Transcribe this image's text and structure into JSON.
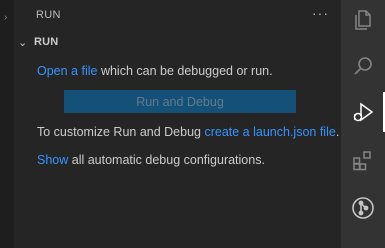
{
  "view": {
    "title": "RUN",
    "section_title": "RUN"
  },
  "content": {
    "open_file_link": "Open a file",
    "open_file_rest": " which can be debugged or run.",
    "run_button_label": "Run and Debug",
    "customize_text": "To customize Run and Debug ",
    "launch_json_link": "create a launch.json file",
    "customize_end": ".",
    "show_link": "Show",
    "show_rest": " all automatic debug configurations."
  },
  "colors": {
    "link": "#3794ff",
    "button": "#0e639c",
    "sidebar_bg": "#252526",
    "activity_bar_bg": "#333333"
  },
  "activity_bar": {
    "items": [
      "explorer-icon",
      "search-icon",
      "run-debug-icon",
      "extensions-icon",
      "source-control-icon"
    ],
    "active": "run-debug-icon"
  }
}
